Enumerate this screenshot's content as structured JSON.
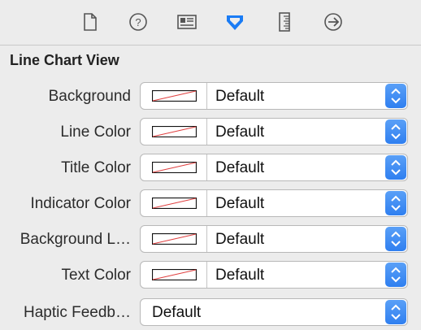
{
  "toolbar": {
    "icons": [
      "file-inspector-icon",
      "quick-help-icon",
      "identity-inspector-icon",
      "attributes-inspector-icon",
      "size-inspector-icon",
      "connections-inspector-icon"
    ],
    "active_icon": "attributes-inspector-icon",
    "active_color": "#1a7cf5"
  },
  "section": {
    "title": "Line Chart View"
  },
  "rows": [
    {
      "label": "Background",
      "value": "Default"
    },
    {
      "label": "Line Color",
      "value": "Default"
    },
    {
      "label": "Title Color",
      "value": "Default"
    },
    {
      "label": "Indicator Color",
      "value": "Default"
    },
    {
      "label": "Background L…",
      "value": "Default"
    },
    {
      "label": "Text Color",
      "value": "Default"
    }
  ],
  "haptic": {
    "label": "Haptic Feedb…",
    "value": "Default"
  }
}
